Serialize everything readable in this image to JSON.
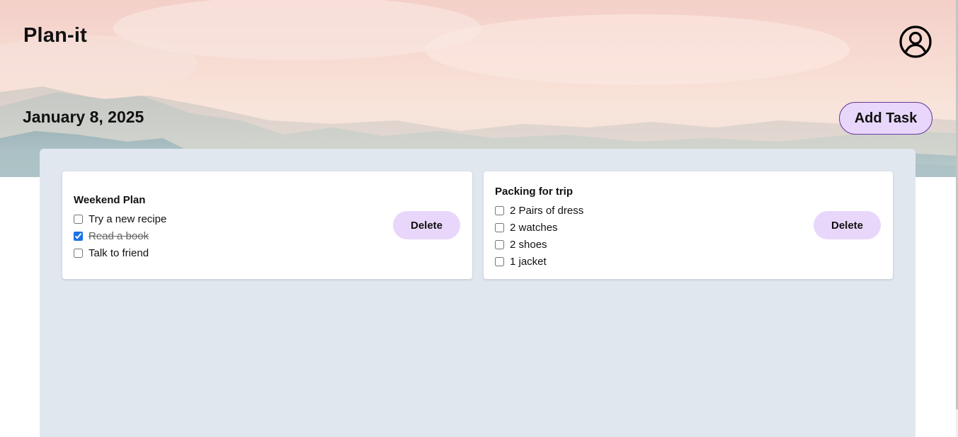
{
  "app": {
    "title": "Plan-it"
  },
  "header": {
    "date": "January 8, 2025",
    "add_task_label": "Add Task",
    "account_icon": "user-circle-icon"
  },
  "colors": {
    "board_bg": "#e1e7ef",
    "button_bg": "#e8d7fb",
    "button_border": "#6a3aa0"
  },
  "cards": [
    {
      "title": "Weekend Plan",
      "items": [
        {
          "label": "Try a new recipe",
          "checked": false
        },
        {
          "label": "Read a book",
          "checked": true
        },
        {
          "label": "Talk to friend",
          "checked": false
        }
      ],
      "delete_label": "Delete"
    },
    {
      "title": "Packing for trip",
      "items": [
        {
          "label": "2 Pairs of dress",
          "checked": false
        },
        {
          "label": "2 watches",
          "checked": false
        },
        {
          "label": "2 shoes",
          "checked": false
        },
        {
          "label": "1 jacket",
          "checked": false
        }
      ],
      "delete_label": "Delete"
    }
  ]
}
